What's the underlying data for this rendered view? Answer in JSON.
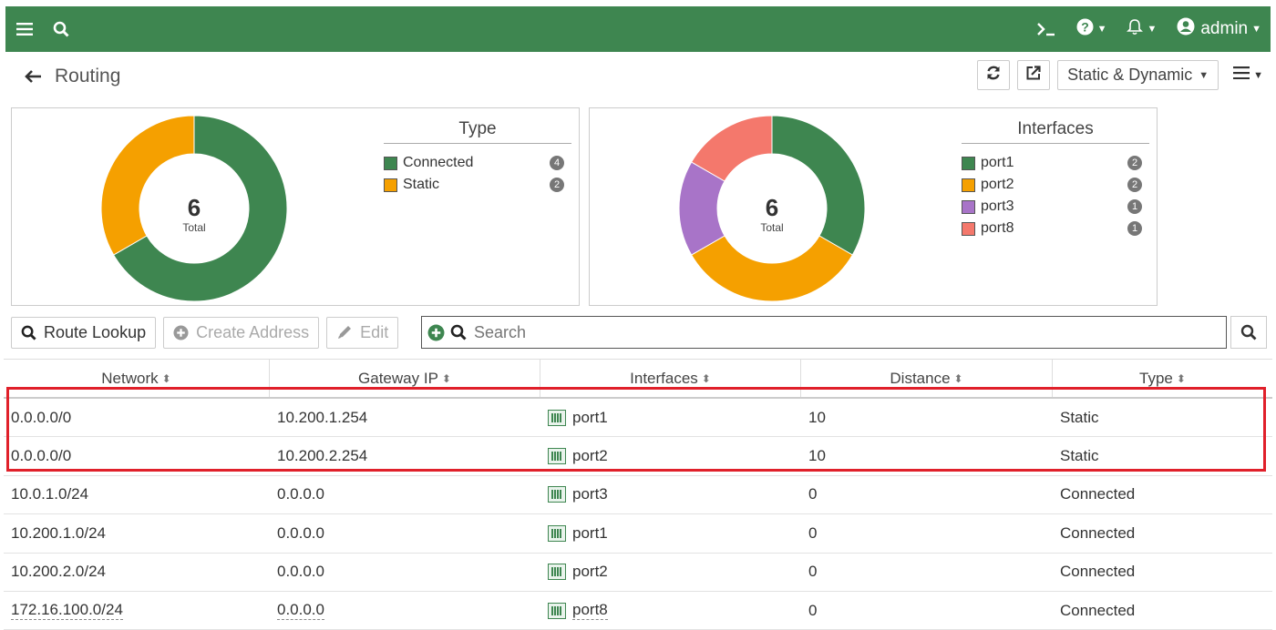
{
  "topbar": {
    "user": "admin",
    "icons": [
      "hamburger-icon",
      "search-icon",
      "cli-icon",
      "help-icon",
      "bell-icon",
      "user-icon"
    ]
  },
  "header": {
    "title": "Routing",
    "view_dropdown": "Static & Dynamic"
  },
  "type_chart": {
    "legend_title": "Type",
    "total": "6",
    "total_label": "Total"
  },
  "interfaces_chart": {
    "legend_title": "Interfaces",
    "total": "6",
    "total_label": "Total"
  },
  "toolbar": {
    "route_lookup": "Route Lookup",
    "create_address": "Create Address",
    "edit": "Edit",
    "search_placeholder": "Search"
  },
  "table": {
    "columns": [
      "Network",
      "Gateway IP",
      "Interfaces",
      "Distance",
      "Type"
    ],
    "rows": [
      {
        "network": "0.0.0.0/0",
        "gateway": "10.200.1.254",
        "interface": "port1",
        "distance": "10",
        "type": "Static"
      },
      {
        "network": "0.0.0.0/0",
        "gateway": "10.200.2.254",
        "interface": "port2",
        "distance": "10",
        "type": "Static"
      },
      {
        "network": "10.0.1.0/24",
        "gateway": "0.0.0.0",
        "interface": "port3",
        "distance": "0",
        "type": "Connected"
      },
      {
        "network": "10.200.1.0/24",
        "gateway": "0.0.0.0",
        "interface": "port1",
        "distance": "0",
        "type": "Connected"
      },
      {
        "network": "10.200.2.0/24",
        "gateway": "0.0.0.0",
        "interface": "port2",
        "distance": "0",
        "type": "Connected"
      },
      {
        "network": "172.16.100.0/24",
        "gateway": "0.0.0.0",
        "interface": "port8",
        "distance": "0",
        "type": "Connected"
      }
    ]
  },
  "chart_data": [
    {
      "type": "pie",
      "title": "Type",
      "categories": [
        "Connected",
        "Static"
      ],
      "values": [
        4,
        2
      ],
      "colors": [
        "#3e8650",
        "#f5a000"
      ]
    },
    {
      "type": "pie",
      "title": "Interfaces",
      "categories": [
        "port1",
        "port2",
        "port3",
        "port8"
      ],
      "values": [
        2,
        2,
        1,
        1
      ],
      "colors": [
        "#3e8650",
        "#f5a000",
        "#a874c8",
        "#f4786c"
      ]
    }
  ]
}
